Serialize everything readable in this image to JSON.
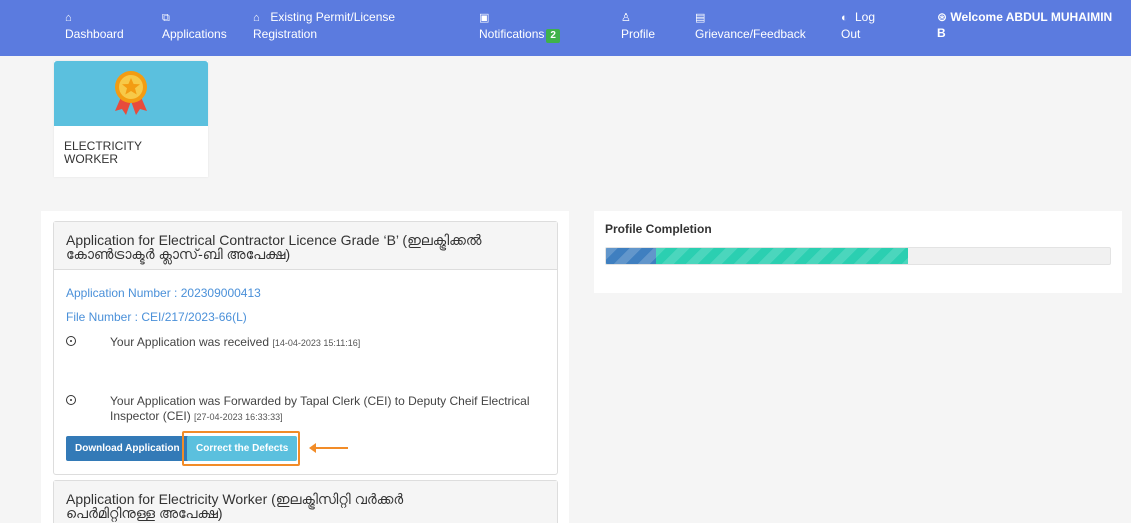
{
  "nav": {
    "dashboard": "Dashboard",
    "applications": "Applications",
    "existing_line1": "Existing Permit/License",
    "existing_line2": "Registration",
    "notifications": "Notifications",
    "notifications_count": "2",
    "profile": "Profile",
    "grievance": "Grievance/Feedback",
    "logout_line1": "Log",
    "logout_line2": "Out",
    "welcome_line1": "Welcome ABDUL MUHAIMIN",
    "welcome_line2": "B"
  },
  "card": {
    "label_line1": "ELECTRICITY",
    "label_line2": "WORKER"
  },
  "application1": {
    "title_line1": "Application for Electrical Contractor Licence Grade ‘B’ (ഇലക്ട്രിക്കൽ",
    "title_line2": "കോൺട്രാക്ടർ ക്ലാസ്-ബി അപേക്ഷ)",
    "app_number": "Application Number : 202309000413",
    "file_number": "File Number : CEI/217/2023-66(L)",
    "timeline": [
      {
        "text": "Your Application was received",
        "time": "[14-04-2023 15:11:16]"
      },
      {
        "text_line1": "Your Application was Forwarded by Tapal Clerk (CEI) to Deputy Cheif Electrical",
        "text_line2": "Inspector (CEI)",
        "time": "[27-04-2023 16:33:33]"
      }
    ],
    "download_button": "Download Application",
    "correct_button": "Correct the Defects"
  },
  "application2": {
    "title_line1": "Application for Electricity Worker (ഇലക്ട്രിസിറ്റി വർക്കർ",
    "title_line2": "പെർമിറ്റിനുള്ള അപേക്ഷ)"
  },
  "profile": {
    "title": "Profile Completion",
    "completion_fraction": 0.6
  },
  "colors": {
    "nav_bg": "#5b7bdf",
    "highlight": "#f28c28",
    "progress_fill": "#2bcfb1"
  }
}
